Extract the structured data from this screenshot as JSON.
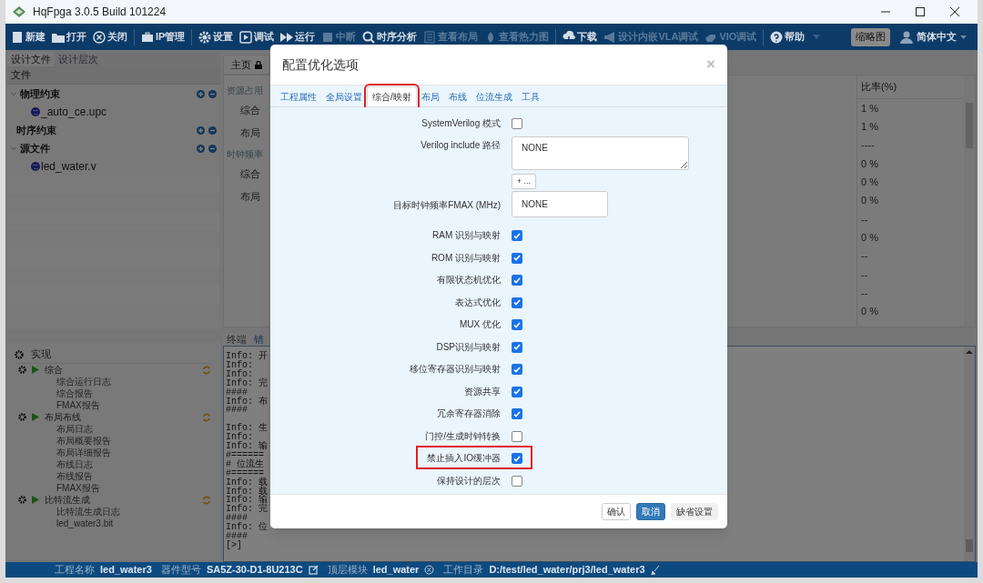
{
  "window": {
    "title": "HqFpga 3.0.5 Build 101224"
  },
  "toolbar": {
    "groups": [
      [
        {
          "label": "新建",
          "disabled": false
        },
        {
          "label": "打开",
          "disabled": false
        },
        {
          "label": "关闭",
          "disabled": false
        }
      ],
      [
        {
          "label": "IP管理",
          "disabled": false
        }
      ],
      [
        {
          "label": "设置",
          "disabled": false
        },
        {
          "label": "调试",
          "disabled": false
        },
        {
          "label": "运行",
          "disabled": false
        },
        {
          "label": "中断",
          "disabled": true
        },
        {
          "label": "时序分析",
          "disabled": false
        },
        {
          "label": "查看布局",
          "disabled": true
        },
        {
          "label": "查看热力图",
          "disabled": true
        }
      ],
      [
        {
          "label": "下载",
          "disabled": false
        },
        {
          "label": "设计内嵌VLA调试",
          "disabled": true
        },
        {
          "label": "VIO调试",
          "disabled": true
        }
      ],
      [
        {
          "label": "帮助",
          "disabled": false
        }
      ]
    ],
    "thumbnail_button": "缩略图",
    "language": "简体中文"
  },
  "sidebar": {
    "tabs": [
      {
        "label": "设计文件",
        "selected": true
      },
      {
        "label": "设计层次",
        "selected": false
      }
    ],
    "header": "文件",
    "tree": [
      {
        "label": "物理约束",
        "expanded": true,
        "children": [
          {
            "label": "_auto_ce.upc"
          }
        ]
      },
      {
        "label": "时序约束"
      },
      {
        "label": "源文件",
        "expanded": true,
        "children": [
          {
            "label": "led_water.v"
          }
        ]
      }
    ]
  },
  "flow": {
    "title": "实现",
    "steps": [
      {
        "label": "综合",
        "children": [
          "综合运行日志",
          "综合报告",
          "FMAX报告"
        ]
      },
      {
        "label": "布局布线",
        "children": [
          "布局日志",
          "布局概要报告",
          "布局详细报告",
          "布线日志",
          "布线报告",
          "FMAX报告"
        ]
      },
      {
        "label": "比特流生成",
        "children": [
          "比特流生成日志",
          "led_water3.bit"
        ]
      }
    ]
  },
  "home": {
    "tab": "主页",
    "left": [
      {
        "kind": "section",
        "text": "资源占用"
      },
      {
        "kind": "row",
        "text": "综合"
      },
      {
        "kind": "row",
        "text": "布局"
      },
      {
        "kind": "section",
        "text": "时钟频率"
      },
      {
        "kind": "row",
        "text": "综合"
      },
      {
        "kind": "row",
        "text": "布局"
      }
    ],
    "ratio_header": "比率(%)",
    "ratios": [
      "1 %",
      "1 %",
      "----",
      "0 %",
      "0 %",
      "0 %",
      "--",
      "0 %",
      "--",
      "--",
      "--",
      "0 %"
    ]
  },
  "console": {
    "tabs": [
      {
        "label": "终端",
        "selected": true
      },
      {
        "label": "错",
        "selected": false
      }
    ],
    "lines": [
      {
        "text": "Info: 开"
      },
      {
        "text": "Info:"
      },
      {
        "text": "Info:"
      },
      {
        "text": "Info: 完"
      },
      {
        "text": "####"
      },
      {
        "text": "Info: 布"
      },
      {
        "text": "####"
      },
      {
        "kind": "blank"
      },
      {
        "text": "Info: 生"
      },
      {
        "text": "Info:"
      },
      {
        "text": "Info: 输"
      },
      {
        "text": "#======"
      },
      {
        "text": "# 位流生"
      },
      {
        "text": "#======"
      },
      {
        "text": "Info: 载"
      },
      {
        "text": "Info: 载"
      },
      {
        "text": "Info: 输"
      },
      {
        "text": "Info: 完"
      },
      {
        "text": "####"
      },
      {
        "text": "Info: 位"
      },
      {
        "text": "####"
      },
      {
        "text": "[>]"
      }
    ]
  },
  "status_bar": [
    {
      "label": "工程名称",
      "value": "led_water3"
    },
    {
      "label": "器件型号",
      "value": "SA5Z-30-D1-8U213C"
    },
    {
      "label": "顶层模块",
      "value": "led_water"
    },
    {
      "label": "工作目录",
      "value": "D:/test/led_water/prj3/led_water3"
    }
  ],
  "dialog": {
    "title": "配置优化选项",
    "close": "×",
    "tabs": [
      {
        "label": "工程属性",
        "selected": false,
        "highlighted": false
      },
      {
        "label": "全局设置",
        "selected": false,
        "highlighted": false
      },
      {
        "label": "综合/映射",
        "selected": true,
        "highlighted": true
      },
      {
        "label": "布局",
        "selected": false,
        "highlighted": false
      },
      {
        "label": "布线",
        "selected": false,
        "highlighted": false
      },
      {
        "label": "位流生成",
        "selected": false,
        "highlighted": false
      },
      {
        "label": "工具",
        "selected": false,
        "highlighted": false
      }
    ],
    "options": [
      {
        "kind": "checkbox",
        "label": "SystemVerilog 模式",
        "checked": false,
        "highlighted": false
      },
      {
        "kind": "textarea",
        "label": "Verilog include 路径",
        "value": "NONE",
        "add_button": "+ ..."
      },
      {
        "kind": "input",
        "label": "目标时钟频率FMAX (MHz)",
        "value": "NONE"
      },
      {
        "kind": "checkbox",
        "label": "RAM 识别与映射",
        "checked": true,
        "highlighted": false
      },
      {
        "kind": "checkbox",
        "label": "ROM 识别与映射",
        "checked": true,
        "highlighted": false
      },
      {
        "kind": "checkbox",
        "label": "有限状态机优化",
        "checked": true,
        "highlighted": false
      },
      {
        "kind": "checkbox",
        "label": "表达式优化",
        "checked": true,
        "highlighted": false
      },
      {
        "kind": "checkbox",
        "label": "MUX 优化",
        "checked": true,
        "highlighted": false
      },
      {
        "kind": "checkbox",
        "label": "DSP识别与映射",
        "checked": true,
        "highlighted": false
      },
      {
        "kind": "checkbox",
        "label": "移位寄存器识别与映射",
        "checked": true,
        "highlighted": false
      },
      {
        "kind": "checkbox",
        "label": "资源共享",
        "checked": true,
        "highlighted": false
      },
      {
        "kind": "checkbox",
        "label": "冗余寄存器消除",
        "checked": true,
        "highlighted": false
      },
      {
        "kind": "checkbox",
        "label": "门控/生成时钟转换",
        "checked": false,
        "highlighted": false
      },
      {
        "kind": "checkbox",
        "label": "禁止插入IO缓冲器",
        "checked": true,
        "highlighted": true
      },
      {
        "kind": "checkbox",
        "label": "保持设计的层次",
        "checked": false,
        "highlighted": false
      }
    ],
    "buttons": [
      {
        "label": "确认",
        "kind": "default"
      },
      {
        "label": "取消",
        "kind": "primary"
      },
      {
        "label": "缺省设置",
        "kind": "plain"
      }
    ]
  }
}
